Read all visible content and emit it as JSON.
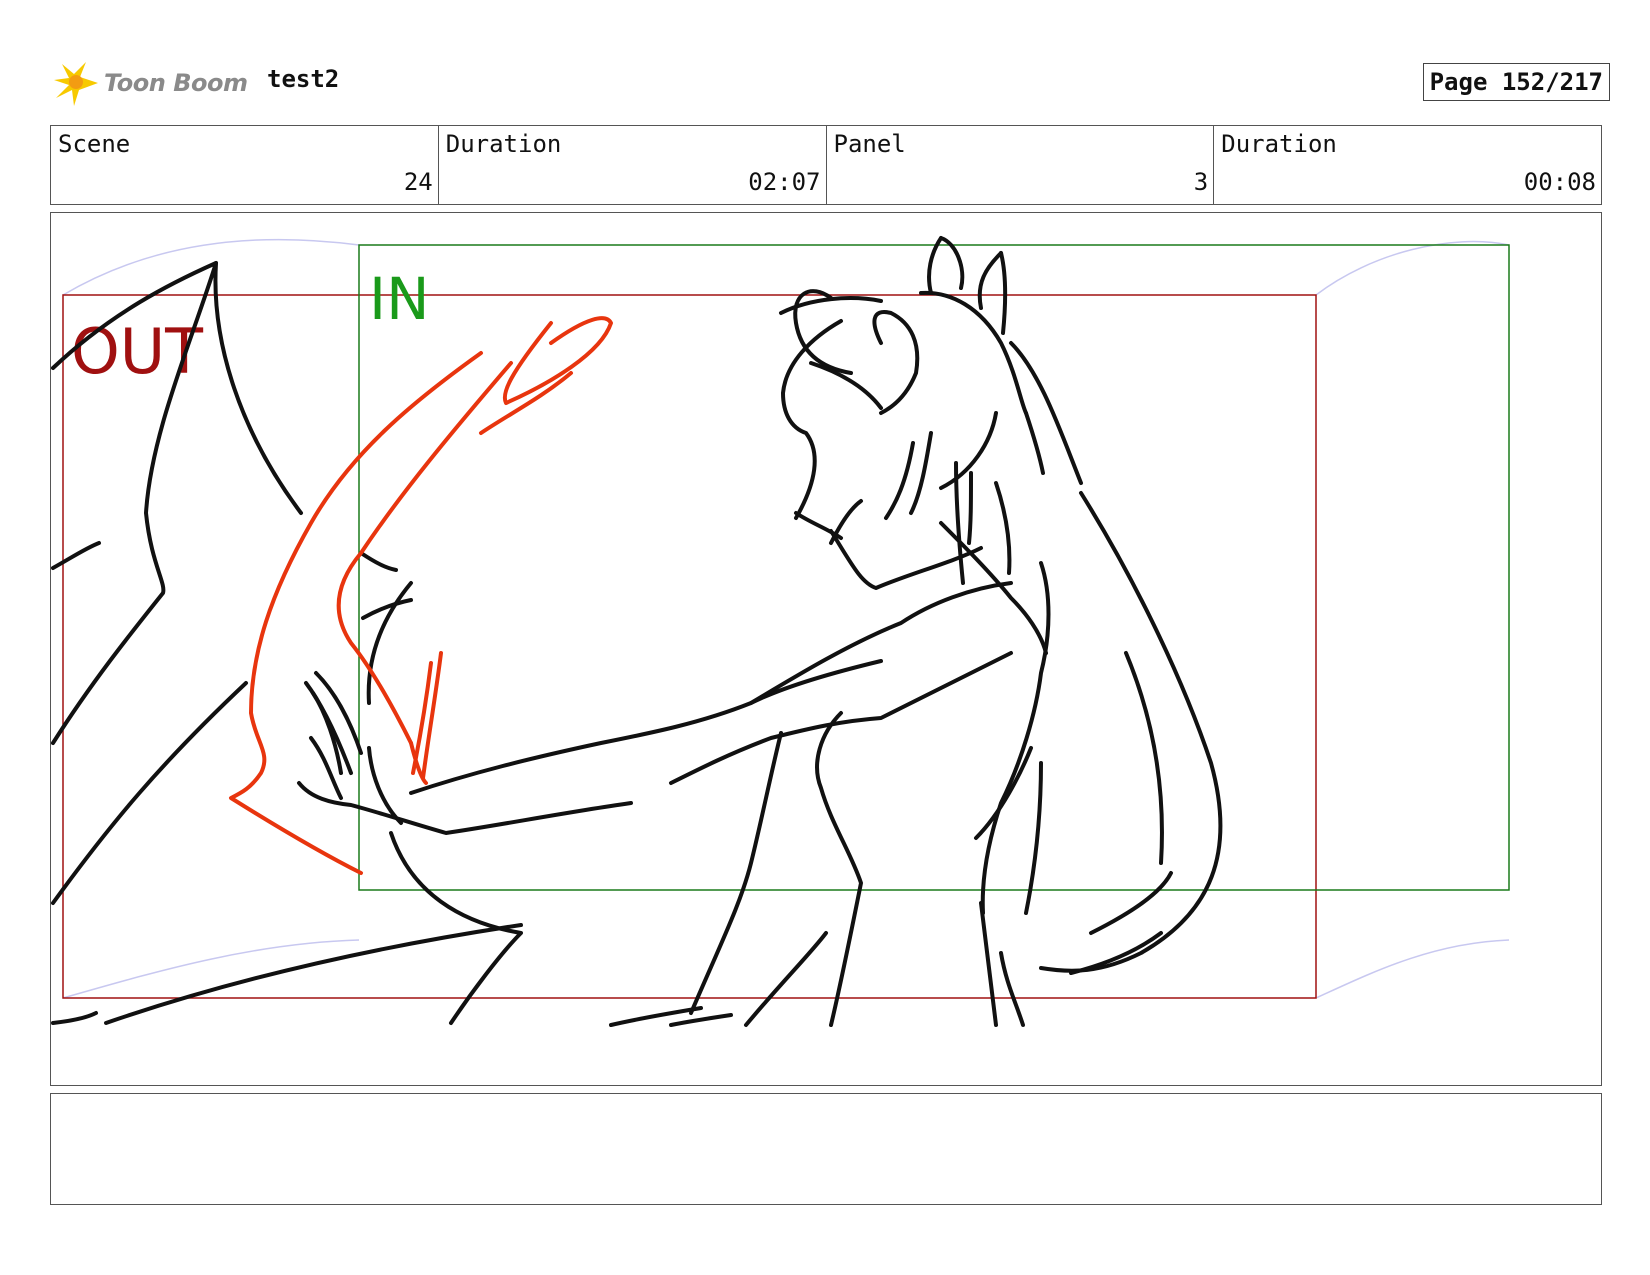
{
  "header": {
    "logo_text": "Toon Boom",
    "project_name": "test2",
    "page_label": "Page 152/217"
  },
  "info": {
    "scene_label": "Scene",
    "scene_value": "24",
    "scene_duration_label": "Duration",
    "scene_duration_value": "02:07",
    "panel_label": "Panel",
    "panel_value": "3",
    "panel_duration_label": "Duration",
    "panel_duration_value": "00:08"
  },
  "frames": {
    "out_label": "OUT",
    "in_label": "IN",
    "out_color": "#a01010",
    "in_color": "#1a9a1a"
  },
  "notes": {
    "text": ""
  }
}
